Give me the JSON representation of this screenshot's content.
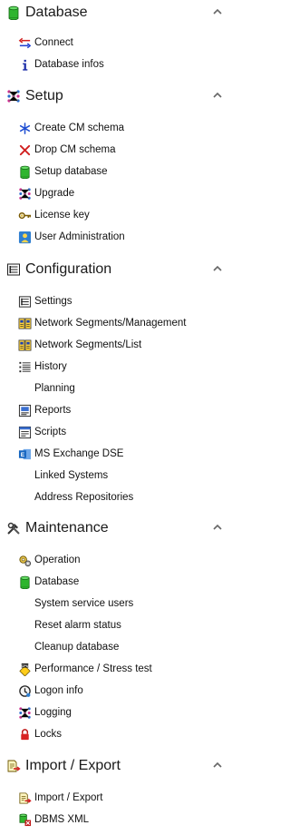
{
  "sections": [
    {
      "title": "Database",
      "icon": "database-icon",
      "items": [
        {
          "label": "Connect",
          "icon": "connect-arrows-icon"
        },
        {
          "label": "Database infos",
          "icon": "info-icon"
        }
      ]
    },
    {
      "title": "Setup",
      "icon": "setup-dots-icon",
      "items": [
        {
          "label": "Create CM schema",
          "icon": "snowflake-icon"
        },
        {
          "label": "Drop CM schema",
          "icon": "red-x-icon"
        },
        {
          "label": "Setup database",
          "icon": "database-icon"
        },
        {
          "label": "Upgrade",
          "icon": "setup-dots-icon"
        },
        {
          "label": "License key",
          "icon": "key-icon"
        },
        {
          "label": "User Administration",
          "icon": "user-admin-icon"
        }
      ]
    },
    {
      "title": "Configuration",
      "icon": "config-list-icon",
      "items": [
        {
          "label": "Settings",
          "icon": "settings-icon"
        },
        {
          "label": "Network Segments/Management",
          "icon": "network-segments-icon"
        },
        {
          "label": "Network Segments/List",
          "icon": "network-segments-icon"
        },
        {
          "label": "History",
          "icon": "history-icon"
        },
        {
          "label": "Planning",
          "icon": ""
        },
        {
          "label": "Reports",
          "icon": "reports-icon"
        },
        {
          "label": "Scripts",
          "icon": "scripts-icon"
        },
        {
          "label": "MS Exchange DSE",
          "icon": "exchange-icon"
        },
        {
          "label": "Linked Systems",
          "icon": ""
        },
        {
          "label": "Address Repositories",
          "icon": ""
        }
      ]
    },
    {
      "title": "Maintenance",
      "icon": "tools-icon",
      "items": [
        {
          "label": "Operation",
          "icon": "gears-icon"
        },
        {
          "label": "Database",
          "icon": "database-icon"
        },
        {
          "label": "System service users",
          "icon": ""
        },
        {
          "label": "Reset alarm status",
          "icon": ""
        },
        {
          "label": "Cleanup database",
          "icon": ""
        },
        {
          "label": "Performance / Stress test",
          "icon": "cpu-icon"
        },
        {
          "label": "Logon info",
          "icon": "logon-info-icon"
        },
        {
          "label": "Logging",
          "icon": "setup-dots-icon"
        },
        {
          "label": "Locks",
          "icon": "lock-icon"
        }
      ]
    },
    {
      "title": "Import / Export",
      "icon": "import-export-icon",
      "items": [
        {
          "label": "Import / Export",
          "icon": "import-export-icon"
        },
        {
          "label": "DBMS XML",
          "icon": "dbms-xml-icon"
        }
      ]
    }
  ],
  "colors": {
    "database_green": "#2fb52f",
    "arrow_red": "#d21f1f",
    "arrow_blue": "#1f3fd2",
    "dots_magenta": "#cc2a8c",
    "dots_blue": "#2a6acc",
    "chevron": "#666666"
  }
}
